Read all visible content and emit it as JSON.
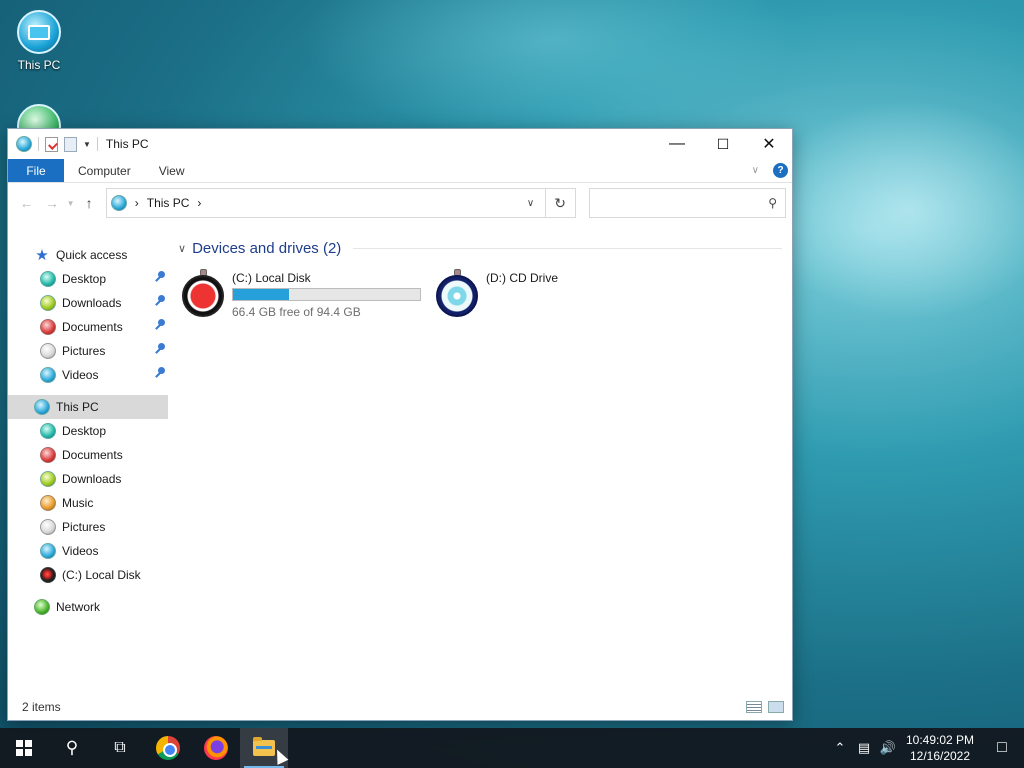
{
  "desktop": {
    "icons": [
      {
        "label": "This PC"
      }
    ]
  },
  "window": {
    "title": "This PC",
    "ribbon_tabs": [
      "File",
      "Computer",
      "View"
    ],
    "address": {
      "crumb": "This PC",
      "separator": "›"
    },
    "search": {
      "placeholder": ""
    },
    "nav": {
      "quick_access": "Quick access",
      "quick_items": [
        "Desktop",
        "Downloads",
        "Documents",
        "Pictures",
        "Videos"
      ],
      "this_pc": "This PC",
      "pc_items": [
        "Desktop",
        "Documents",
        "Downloads",
        "Music",
        "Pictures",
        "Videos",
        "(C:) Local Disk"
      ],
      "network": "Network"
    },
    "group": {
      "title": "Devices and drives (2)"
    },
    "drives": [
      {
        "name": "(C:) Local Disk",
        "free_text": "66.4 GB free of 94.4 GB",
        "used_fraction": 0.297
      },
      {
        "name": "(D:) CD Drive"
      }
    ],
    "status": {
      "items": "2 items"
    }
  },
  "taskbar": {
    "clock_time": "10:49:02 PM",
    "clock_date": "12/16/2022"
  },
  "colors": {
    "accent": "#1a6fc2",
    "progress": "#26a0da",
    "group_header": "#1e3d8a"
  }
}
